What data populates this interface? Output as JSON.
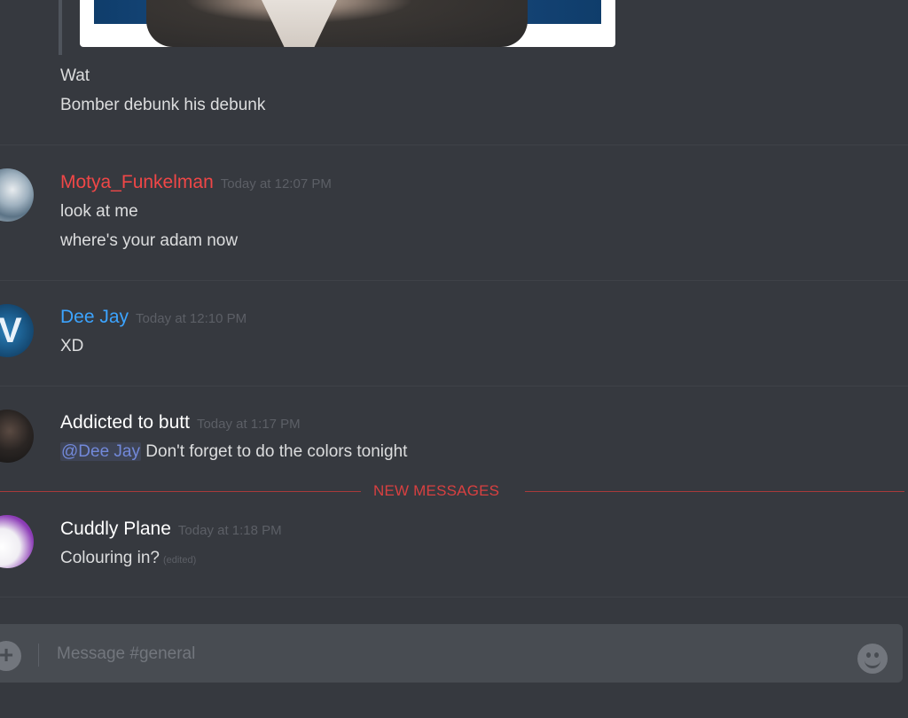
{
  "previous_messages": [
    "Wat",
    "Bomber debunk his debunk"
  ],
  "messages": [
    {
      "username": "Motya_Funkelman",
      "color": "#f04747",
      "timestamp": "Today at 12:07 PM",
      "lines": [
        "look at me",
        "where's your adam now"
      ]
    },
    {
      "username": "Dee Jay",
      "color": "#3ca4ff",
      "timestamp": "Today at 12:10 PM",
      "lines": [
        "XD"
      ]
    },
    {
      "username": "Addicted to butt",
      "color": "#ffffff",
      "timestamp": "Today at 1:17 PM",
      "mention": "@Dee Jay",
      "text": "Don't forget to do the colors tonight"
    },
    {
      "username": "Cuddly Plane",
      "color": "#ffffff",
      "timestamp": "Today at 1:18 PM",
      "text": "Colouring in?",
      "edited": "(edited)"
    }
  ],
  "new_messages_label": "NEW MESSAGES",
  "composer": {
    "placeholder": "Message #general",
    "plus_icon": "plus-icon",
    "emoji_icon": "emoji-icon"
  },
  "colors": {
    "background": "#36393f",
    "new_messages": "#f04747",
    "mention": "#7289da"
  }
}
